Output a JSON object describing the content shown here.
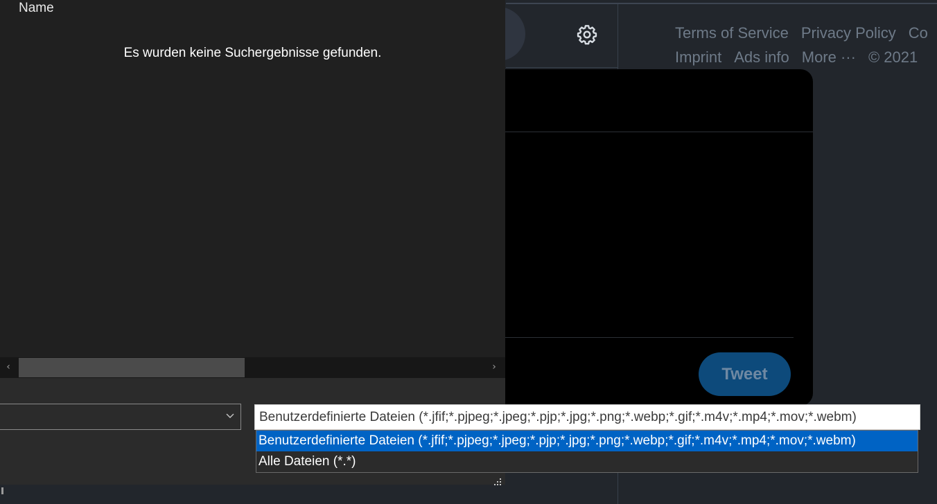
{
  "twitter": {
    "footer": {
      "row1": [
        "Terms of Service",
        "Privacy Policy",
        "Co"
      ],
      "row2": [
        "Imprint",
        "Ads info",
        "More ···",
        "© 2021"
      ]
    },
    "tweet_label": "Tweet",
    "settings_icon": "gear-icon",
    "colors": {
      "background": "#22262c",
      "compose": "#000000",
      "tweet_button": "#0d4a7b"
    }
  },
  "dialog": {
    "column_header": "Name",
    "empty_message": "Es wurden keine Suchergebnisse gefunden.",
    "filename_value": "",
    "filter": {
      "selected": "Benutzerdefinierte Dateien (*.jfif;*.pjpeg;*.jpeg;*.pjp;*.jpg;*.png;*.webp;*.gif;*.m4v;*.mp4;*.mov;*.webm)",
      "options": [
        "Benutzerdefinierte Dateien (*.jfif;*.pjpeg;*.jpeg;*.pjp;*.jpg;*.png;*.webp;*.gif;*.m4v;*.mp4;*.mov;*.webm)",
        "Alle Dateien (*.*)"
      ]
    },
    "scroll": {
      "left_arrow": "‹",
      "right_arrow": "›"
    },
    "colors": {
      "list_bg": "#202020",
      "selection": "#0063c4"
    }
  }
}
